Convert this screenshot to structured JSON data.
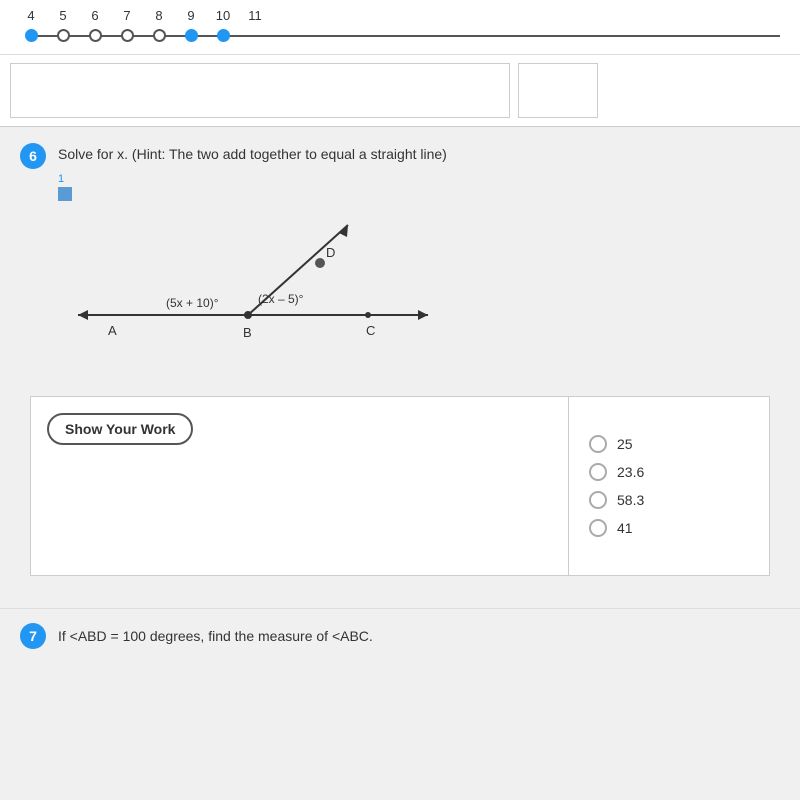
{
  "numberLine": {
    "labels": [
      "4",
      "5",
      "6",
      "7",
      "8",
      "9",
      "10",
      "11"
    ],
    "dots": [
      "filled",
      "empty",
      "empty",
      "empty",
      "empty",
      "filled",
      "filled"
    ]
  },
  "inputArea": {
    "placeholder": ""
  },
  "question6": {
    "number": "6",
    "sublabel": "1",
    "text": "Solve for x. (Hint: The two add together to equal a straight line)",
    "diagram": {
      "angle1": "(5x + 10)°",
      "angle2": "(2x – 5)°",
      "labelA": "A",
      "labelB": "B",
      "labelC": "C",
      "labelD": "D"
    },
    "showWorkLabel": "Show Your Work",
    "choices": [
      {
        "value": "25",
        "id": "c1"
      },
      {
        "value": "23.6",
        "id": "c2"
      },
      {
        "value": "58.3",
        "id": "c3"
      },
      {
        "value": "41",
        "id": "c4"
      }
    ]
  },
  "question7": {
    "number": "7",
    "text": "If <ABD = 100 degrees, find the measure of <ABC."
  }
}
